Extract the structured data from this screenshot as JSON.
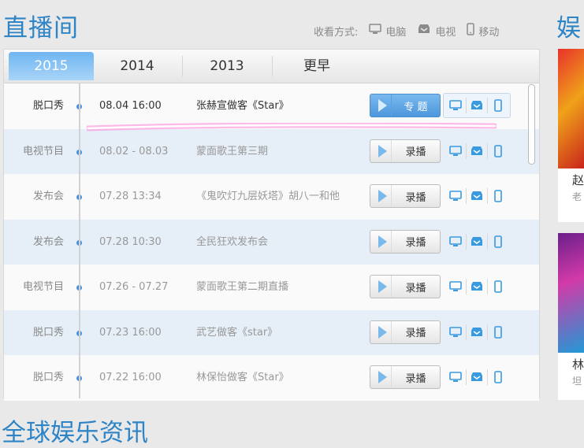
{
  "page_title": "直播间",
  "watch_modes": {
    "label": "收看方式:",
    "items": [
      {
        "label": "电脑",
        "icon": "monitor-icon"
      },
      {
        "label": "电视",
        "icon": "tv-box-icon"
      },
      {
        "label": "移动",
        "icon": "phone-icon"
      }
    ]
  },
  "right_section_title": "娱",
  "side_cards": [
    {
      "title": "赵",
      "subtitle": "老"
    },
    {
      "title": "林",
      "subtitle": "坦"
    }
  ],
  "tabs": [
    {
      "label": "2015",
      "active": true
    },
    {
      "label": "2014",
      "active": false
    },
    {
      "label": "2013",
      "active": false
    },
    {
      "label": "更早",
      "active": false
    }
  ],
  "schedule": [
    {
      "category": "脱口秀",
      "date": "08.04 16:00",
      "title": "张赫宣做客《Star》",
      "button": "专 题",
      "active": true
    },
    {
      "category": "电视节目",
      "date": "08.02 - 08.03",
      "title": "蒙面歌王第三期",
      "button": "录播",
      "active": false
    },
    {
      "category": "发布会",
      "date": "07.28 13:34",
      "title": "《鬼吹灯九层妖塔》胡八一和他",
      "button": "录播",
      "active": false
    },
    {
      "category": "发布会",
      "date": "07.28 10:30",
      "title": "全民狂欢发布会",
      "button": "录播",
      "active": false
    },
    {
      "category": "电视节目",
      "date": "07.26 - 07.27",
      "title": "蒙面歌王第二期直播",
      "button": "录播",
      "active": false
    },
    {
      "category": "脱口秀",
      "date": "07.23 16:00",
      "title": "武艺做客《star》",
      "button": "录播",
      "active": false
    },
    {
      "category": "脱口秀",
      "date": "07.22 16:00",
      "title": "林保怡做客《Star》",
      "button": "录播",
      "active": false
    }
  ],
  "colors": {
    "accent": "#2f84c6",
    "active_tab": "#6fb6f2",
    "highlight": "#ff5fc8"
  },
  "bottom_title": "全球娱乐资讯"
}
